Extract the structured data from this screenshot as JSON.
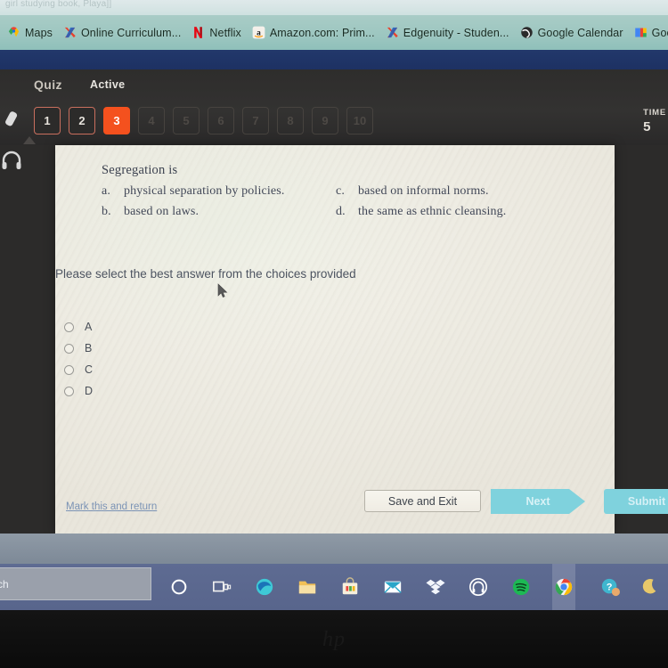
{
  "window": {
    "title_fragment": "girl studying book, Playa]]"
  },
  "bookmarks": {
    "items": [
      {
        "label": "Maps",
        "icon": "maps-pin-icon"
      },
      {
        "label": "Online Curriculum...",
        "icon": "edgenuity-x-icon"
      },
      {
        "label": "Netflix",
        "icon": "netflix-icon"
      },
      {
        "label": "Amazon.com: Prim...",
        "icon": "amazon-icon"
      },
      {
        "label": "Edgenuity - Studen...",
        "icon": "edgenuity-x-icon"
      },
      {
        "label": "Google Calendar",
        "icon": "globe-icon"
      },
      {
        "label": "Goo",
        "icon": "google-drive-icon"
      }
    ]
  },
  "quiz_header": {
    "title": "Quiz",
    "status": "Active",
    "question_numbers": [
      {
        "label": "1",
        "state": "done"
      },
      {
        "label": "2",
        "state": "done"
      },
      {
        "label": "3",
        "state": "current"
      },
      {
        "label": "4",
        "state": "locked"
      },
      {
        "label": "5",
        "state": "locked"
      },
      {
        "label": "6",
        "state": "locked"
      },
      {
        "label": "7",
        "state": "locked"
      },
      {
        "label": "8",
        "state": "locked"
      },
      {
        "label": "9",
        "state": "locked"
      },
      {
        "label": "10",
        "state": "locked"
      }
    ],
    "timer_label": "TIME",
    "timer_value": "5"
  },
  "rail": {
    "pencil_icon": "pencil-icon",
    "headphones_icon": "headphones-icon"
  },
  "question": {
    "stem": "Segregation is",
    "choices_left": [
      {
        "letter": "a.",
        "text": "physical separation by policies."
      },
      {
        "letter": "b.",
        "text": "based on laws."
      }
    ],
    "choices_right": [
      {
        "letter": "c.",
        "text": "based on informal norms."
      },
      {
        "letter": "d.",
        "text": "the same as ethnic cleansing."
      }
    ],
    "instruction": "Please select the best answer from the choices provided",
    "answer_options": [
      {
        "label": "A",
        "selected": false
      },
      {
        "label": "B",
        "selected": false
      },
      {
        "label": "C",
        "selected": false
      },
      {
        "label": "D",
        "selected": false
      }
    ]
  },
  "footer": {
    "mark_link": "Mark this and return",
    "save_label": "Save and Exit",
    "next_label": "Next",
    "submit_label": "Submit"
  },
  "taskbar": {
    "search_placeholder": "ch",
    "items": [
      {
        "name": "cortana-icon"
      },
      {
        "name": "task-view-icon"
      },
      {
        "name": "edge-icon"
      },
      {
        "name": "file-explorer-icon"
      },
      {
        "name": "microsoft-store-icon"
      },
      {
        "name": "mail-icon"
      },
      {
        "name": "dropbox-icon"
      },
      {
        "name": "headphones-app-icon"
      },
      {
        "name": "spotify-icon"
      },
      {
        "name": "chrome-icon"
      }
    ],
    "tray": [
      {
        "name": "help-icon"
      },
      {
        "name": "moon-icon"
      }
    ]
  },
  "colors": {
    "accent_orange": "#f4511e",
    "bookmark_bar": "#9cc6c0",
    "button_teal": "#7fd2dd",
    "taskbar": "#5e6b92"
  }
}
